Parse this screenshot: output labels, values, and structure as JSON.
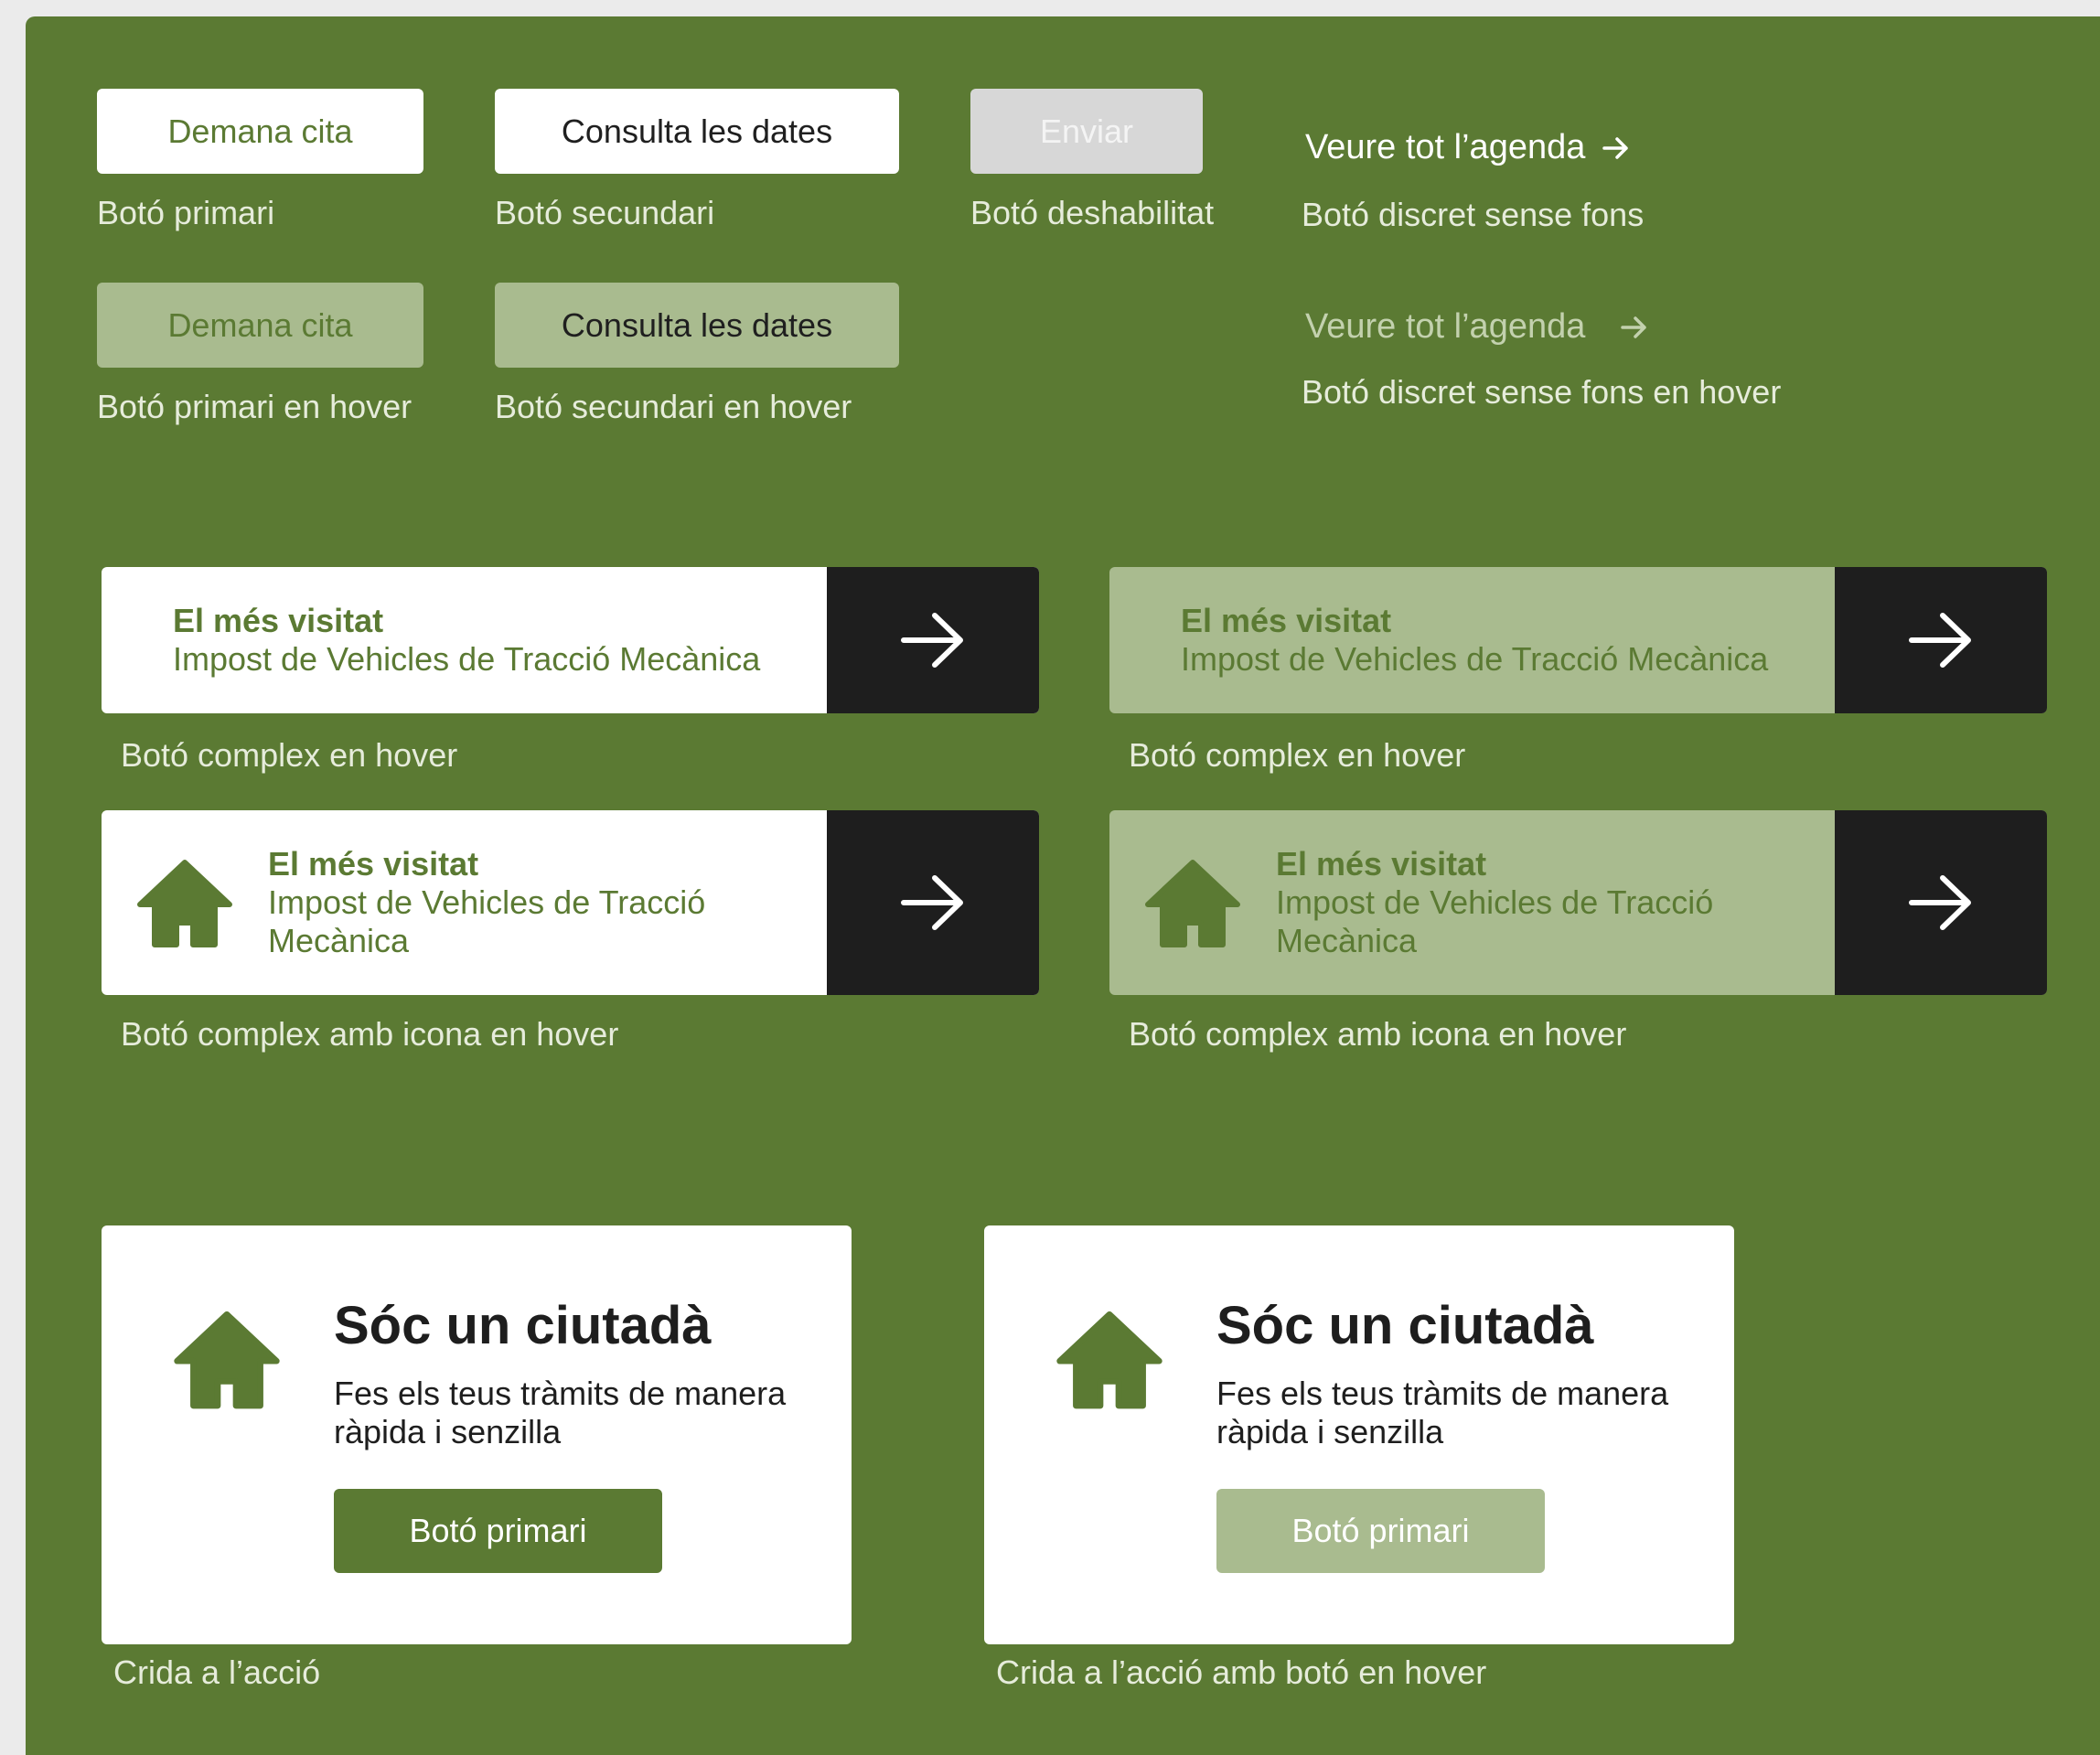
{
  "colors": {
    "brand_green": "#5b7a33",
    "hover_green": "#a9bb8f",
    "dark": "#1e1e1e",
    "disabled": "#d7d7d7"
  },
  "simple_buttons": {
    "primary": {
      "label": "Demana cita",
      "caption": "Botó primari"
    },
    "secondary": {
      "label": "Consulta les dates",
      "caption": "Botó secundari"
    },
    "disabled": {
      "label": "Enviar",
      "caption": "Botó deshabilitat"
    },
    "discreet": {
      "label": "Veure tot l’agenda",
      "icon": "arrow-right-icon",
      "caption": "Botó discret sense fons"
    },
    "primary_hover": {
      "label": "Demana cita",
      "caption": "Botó primari en hover"
    },
    "secondary_hover": {
      "label": "Consulta les dates",
      "caption": "Botó secundari en hover"
    },
    "discreet_hover": {
      "label": "Veure tot l’agenda",
      "icon": "arrow-right-icon",
      "caption": "Botó discret sense fons en hover"
    }
  },
  "complex_buttons": [
    {
      "eyebrow": "El més visitat",
      "title": "Impost de Vehicles de Tracció Mecànica",
      "caption": "Botó complex en hover",
      "icon": "arrow-right-icon"
    },
    {
      "eyebrow": "El més visitat",
      "title": "Impost de Vehicles de Tracció Mecànica",
      "caption": "Botó complex en hover",
      "icon": "arrow-right-icon"
    },
    {
      "eyebrow": "El més visitat",
      "title_line1": "Impost de Vehicles de Tracció",
      "title_line2": "Mecànica",
      "caption": "Botó complex amb icona en hover",
      "leading_icon": "home-icon"
    },
    {
      "eyebrow": "El més visitat",
      "title_line1": "Impost de Vehicles de Tracció",
      "title_line2": "Mecànica",
      "caption": "Botó complex amb icona en hover",
      "leading_icon": "home-icon"
    }
  ],
  "cta_cards": [
    {
      "title": "Sóc un ciutadà",
      "desc_line1": "Fes els teus tràmits de manera",
      "desc_line2": "ràpida i senzilla",
      "button": "Botó primari",
      "caption": "Crida a l’acció",
      "icon": "home-icon"
    },
    {
      "title": "Sóc un ciutadà",
      "desc_line1": "Fes els teus tràmits de manera",
      "desc_line2": "ràpida i senzilla",
      "button": "Botó primari",
      "caption": "Crida a l’acció amb botó en hover",
      "icon": "home-icon"
    }
  ]
}
